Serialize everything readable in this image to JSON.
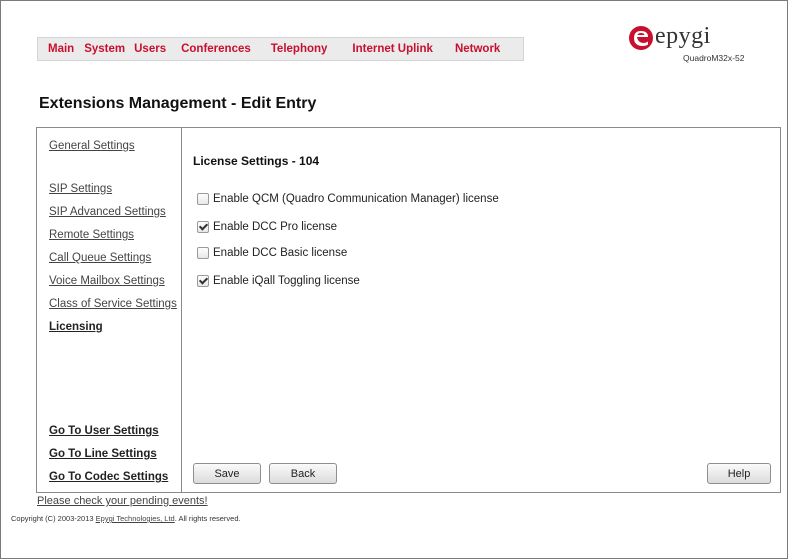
{
  "colors": {
    "nav_text": "#c8102e",
    "logo_accent": "#c8102e"
  },
  "nav": {
    "items": [
      {
        "label": "Main"
      },
      {
        "label": "System"
      },
      {
        "label": "Users"
      },
      {
        "label": "Conferences"
      },
      {
        "label": "Telephony"
      },
      {
        "label": "Internet Uplink"
      },
      {
        "label": "Network"
      }
    ]
  },
  "logo": {
    "brand": "epygi",
    "model": "QuadroM32x-52",
    "icon": "epygi-logo-icon"
  },
  "page_title": "Extensions Management - Edit Entry",
  "sidebar": {
    "links": [
      {
        "label": "General Settings"
      },
      {
        "label": "SIP Settings"
      },
      {
        "label": "SIP Advanced Settings"
      },
      {
        "label": "Remote Settings"
      },
      {
        "label": "Call Queue Settings"
      },
      {
        "label": "Voice Mailbox Settings"
      },
      {
        "label": "Class of Service Settings"
      },
      {
        "label": "Licensing"
      }
    ],
    "goto": [
      {
        "label": "Go To User Settings"
      },
      {
        "label": "Go To Line Settings"
      },
      {
        "label": "Go To Codec Settings"
      }
    ]
  },
  "content": {
    "title": "License Settings - 104",
    "options": [
      {
        "label": "Enable QCM (Quadro Communication Manager) license",
        "checked": false
      },
      {
        "label": "Enable DCC Pro license",
        "checked": true
      },
      {
        "label": "Enable DCC Basic license",
        "checked": false
      },
      {
        "label": "Enable iQall Toggling license",
        "checked": true
      }
    ]
  },
  "buttons": {
    "save": "Save",
    "back": "Back",
    "help": "Help"
  },
  "footer": {
    "pending": "Please check your pending events!",
    "copyright_prefix": "Copyright (C) 2003-2013 ",
    "copyright_link": "Epygi Technologies, Ltd",
    "copyright_suffix": ". All rights reserved."
  }
}
